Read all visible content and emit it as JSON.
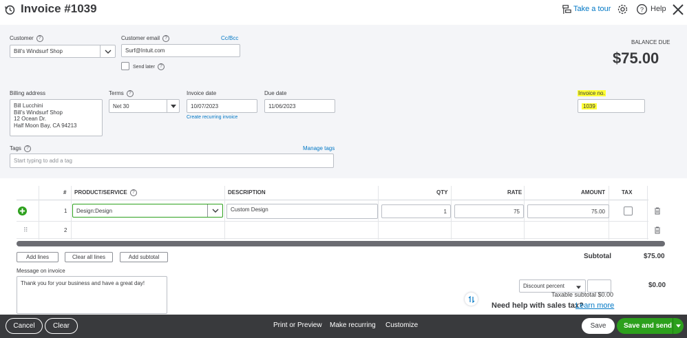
{
  "header": {
    "title": "Invoice #1039",
    "take_tour": "Take a tour",
    "help": "Help"
  },
  "customer": {
    "label": "Customer",
    "value": "Bill's Windsurf Shop"
  },
  "email": {
    "label": "Customer email",
    "value": "Surf@Intuit.com",
    "cc_bcc": "Cc/Bcc",
    "send_later": "Send later"
  },
  "balance": {
    "label": "BALANCE DUE",
    "amount": "$75.00"
  },
  "billing": {
    "label": "Billing address",
    "lines": [
      "Bill Lucchini",
      "Bill's Windsurf Shop",
      "12 Ocean Dr.",
      "Half Moon Bay, CA  94213"
    ]
  },
  "terms": {
    "label": "Terms",
    "value": "Net 30"
  },
  "invoice_date": {
    "label": "Invoice date",
    "value": "10/07/2023",
    "recurring_link": "Create recurring invoice"
  },
  "due_date": {
    "label": "Due date",
    "value": "11/06/2023"
  },
  "invoice_no": {
    "label": "Invoice no.",
    "value": "1039"
  },
  "tags": {
    "label": "Tags",
    "manage": "Manage tags",
    "placeholder": "Start typing to add a tag"
  },
  "table": {
    "headers": {
      "num": "#",
      "product": "PRODUCT/SERVICE",
      "description": "DESCRIPTION",
      "qty": "QTY",
      "rate": "RATE",
      "amount": "AMOUNT",
      "tax": "TAX"
    },
    "rows": [
      {
        "num": "1",
        "product": "Design:Design",
        "description": "Custom Design",
        "qty": "1",
        "rate": "75",
        "amount": "75.00"
      },
      {
        "num": "2"
      }
    ]
  },
  "actions": {
    "add_lines": "Add lines",
    "clear_all": "Clear all lines",
    "add_subtotal": "Add subtotal"
  },
  "message": {
    "label": "Message on invoice",
    "value": "Thank you for your business and have a great day!"
  },
  "totals": {
    "subtotal_label": "Subtotal",
    "subtotal_value": "$75.00",
    "discount_select": "Discount percent",
    "discount_value": "$0.00",
    "taxable_subtotal": "Taxable subtotal $0.00",
    "sales_tax_help": "Need help with sales tax?",
    "learn_more": "Learn more"
  },
  "footer": {
    "cancel": "Cancel",
    "clear": "Clear",
    "print_preview": "Print or Preview",
    "make_recurring": "Make recurring",
    "customize": "Customize",
    "save": "Save",
    "save_send": "Save and send"
  },
  "colors": {
    "accent": "#2ca01c",
    "link": "#0077c5",
    "highlight": "#ffff33",
    "footer": "#393a3d"
  }
}
